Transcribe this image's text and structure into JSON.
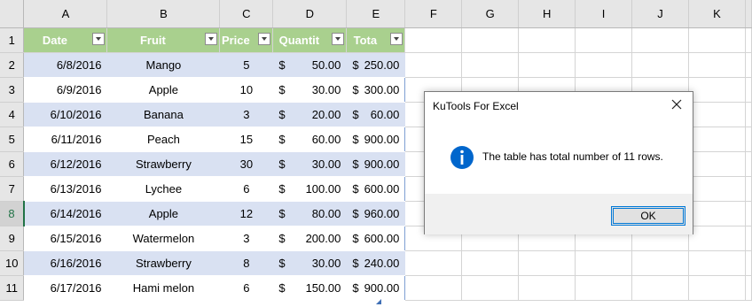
{
  "columns": [
    "A",
    "B",
    "C",
    "D",
    "E",
    "F",
    "G",
    "H",
    "I",
    "J",
    "K"
  ],
  "rows": [
    "1",
    "2",
    "3",
    "4",
    "5",
    "6",
    "7",
    "8",
    "9",
    "10",
    "11"
  ],
  "table": {
    "headers": [
      "Date",
      "Fruit",
      "Price",
      "Quantit",
      "Tota"
    ],
    "data": [
      {
        "date": "6/8/2016",
        "fruit": "Mango",
        "price": "5",
        "qty_sym": "$",
        "qty": "50.00",
        "total_sym": "$",
        "total": "250.00"
      },
      {
        "date": "6/9/2016",
        "fruit": "Apple",
        "price": "10",
        "qty_sym": "$",
        "qty": "30.00",
        "total_sym": "$",
        "total": "300.00"
      },
      {
        "date": "6/10/2016",
        "fruit": "Banana",
        "price": "3",
        "qty_sym": "$",
        "qty": "20.00",
        "total_sym": "$",
        "total": "60.00"
      },
      {
        "date": "6/11/2016",
        "fruit": "Peach",
        "price": "15",
        "qty_sym": "$",
        "qty": "60.00",
        "total_sym": "$",
        "total": "900.00"
      },
      {
        "date": "6/12/2016",
        "fruit": "Strawberry",
        "price": "30",
        "qty_sym": "$",
        "qty": "30.00",
        "total_sym": "$",
        "total": "900.00"
      },
      {
        "date": "6/13/2016",
        "fruit": "Lychee",
        "price": "6",
        "qty_sym": "$",
        "qty": "100.00",
        "total_sym": "$",
        "total": "600.00"
      },
      {
        "date": "6/14/2016",
        "fruit": "Apple",
        "price": "12",
        "qty_sym": "$",
        "qty": "80.00",
        "total_sym": "$",
        "total": "960.00"
      },
      {
        "date": "6/15/2016",
        "fruit": "Watermelon",
        "price": "3",
        "qty_sym": "$",
        "qty": "200.00",
        "total_sym": "$",
        "total": "600.00"
      },
      {
        "date": "6/16/2016",
        "fruit": "Strawberry",
        "price": "8",
        "qty_sym": "$",
        "qty": "30.00",
        "total_sym": "$",
        "total": "240.00"
      },
      {
        "date": "6/17/2016",
        "fruit": "Hami melon",
        "price": "6",
        "qty_sym": "$",
        "qty": "150.00",
        "total_sym": "$",
        "total": "900.00"
      }
    ]
  },
  "dialog": {
    "title": "KuTools For Excel",
    "message": "The table has total number of 11 rows.",
    "ok_label": "OK",
    "icon": "info-icon",
    "icon_color": "#0066cc"
  },
  "colors": {
    "header_fill": "#a9d08e",
    "band_fill": "#d9e1f2",
    "selected_row_accent": "#217346"
  }
}
